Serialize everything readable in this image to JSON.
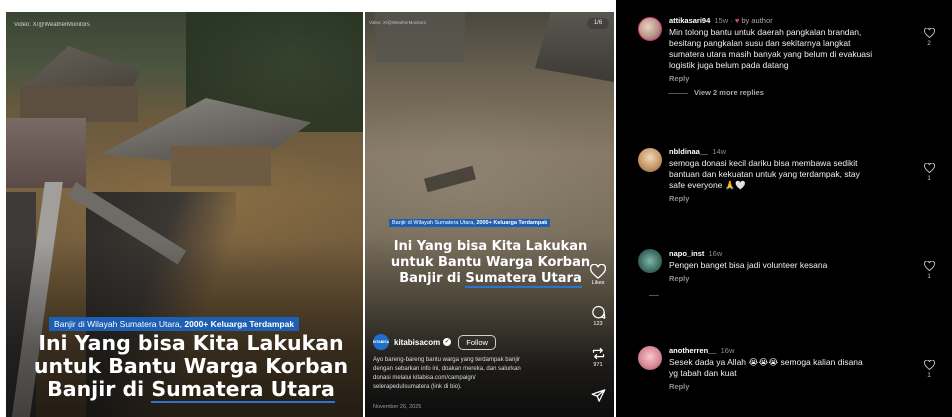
{
  "video_panel": {
    "credit": "Video: X/@WeatherMonitors",
    "tag_plain": "Banjir di Wilayah Sumatera Utara, ",
    "tag_bold": "2000+ Keluarga Terdampak",
    "headline_line1": "Ini Yang bisa Kita Lakukan",
    "headline_line2": "untuk Bantu Warga Korban",
    "headline_line3_plain": "Banjir di ",
    "headline_line3_underlined": "Sumatera Utara"
  },
  "reel_panel": {
    "credit": "Video: X/@WeatherMonitors",
    "counter": "1/6",
    "tag_plain": "Banjir di Wilayah Sumatera Utara, ",
    "tag_bold": "2000+ Keluarga Terdampak",
    "headline_line1": "Ini Yang bisa Kita Lakukan",
    "headline_line2": "untuk Bantu Warga Korban",
    "headline_line3_plain": "Banjir di ",
    "headline_line3_underlined": "Sumatera Utara",
    "likes_label": "Likes",
    "comments_count": "123",
    "reposts_count": "971",
    "avatar_text": "KITABISA",
    "username": "kitabisacom",
    "verified_glyph": "✓",
    "follow_label": "Follow",
    "caption_lines": [
      "Ayo bareng-bareng bantu warga yang terdampak banjir",
      "dengan sebarkan info ini, doakan mereka, dan salurkan",
      "donasi melalui kitabisa.com/campaign/",
      "selerapeduIsumatera (link di bio)."
    ],
    "date": "November 26, 2025"
  },
  "comments_panel": {
    "comments": [
      {
        "username": "attikasari94",
        "time": "15w",
        "author_mark": "♥",
        "author_label": "by author",
        "text_lines": [
          "Min tolong bantu untuk daerah pangkalan brandan,",
          "besitang pangkalan susu dan sekitarnya langkat",
          "sumatera utara masih banyak yang belum di evakuasi",
          "logistik juga belum pada datang"
        ],
        "reply": "Reply",
        "likes": "2"
      },
      {
        "username": "nbldinaa__",
        "time": "14w",
        "text_lines": [
          "semoga donasi kecil dariku bisa membawa sedikit",
          "bantuan dan kekuatan untuk yang terdampak, stay",
          "safe everyone 🙏🤍"
        ],
        "reply": "Reply",
        "likes": "1"
      },
      {
        "username": "napo_inst",
        "time": "16w",
        "text_lines": [
          "Pengen banget bisa jadi volunteer kesana"
        ],
        "reply": "Reply",
        "likes": "1"
      },
      {
        "username": "anotherren__",
        "time": "16w",
        "text_lines": [
          "Sesek dada ya Allah 😭😭😭 semoga kalian disana",
          "yg tabah dan kuat"
        ],
        "reply": "Reply",
        "likes": "1"
      }
    ],
    "view_more_label": "View 2 more replies"
  },
  "colors": {
    "tag_blue": "#1d5fb3",
    "underline_blue": "#2b74d6",
    "comments_bg": "#000000",
    "author_heart": "#ed4956"
  },
  "icons": [
    "heart-icon",
    "comment-icon",
    "repost-icon",
    "share-icon",
    "verified-badge-icon"
  ]
}
